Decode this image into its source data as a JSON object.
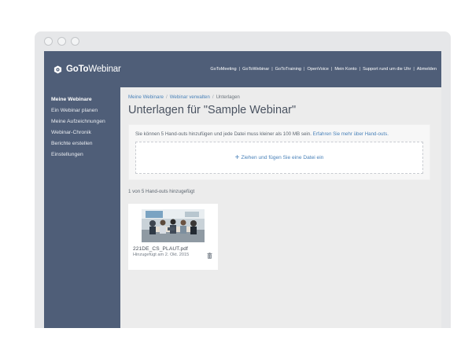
{
  "app": {
    "logo": {
      "brand_bold": "GoTo",
      "brand_light": "Webinar",
      "icon": "gotowebinar-logo-icon"
    }
  },
  "header": {
    "nav": [
      {
        "label": "GoToMeeting"
      },
      {
        "label": "GoToWebinar"
      },
      {
        "label": "GoToTraining"
      },
      {
        "label": "OpenVoice"
      },
      {
        "label": "Mein Konto"
      },
      {
        "label": "Support rund um die Uhr"
      },
      {
        "label": "Abmelden"
      }
    ]
  },
  "sidebar": {
    "items": [
      {
        "label": "Meine Webinare",
        "active": true
      },
      {
        "label": "Ein Webinar planen"
      },
      {
        "label": "Meine Aufzeichnungen"
      },
      {
        "label": "Webinar-Chronik"
      },
      {
        "label": "Berichte erstellen"
      },
      {
        "label": "Einstellungen"
      }
    ]
  },
  "main": {
    "breadcrumb": [
      {
        "label": "Meine Webinare"
      },
      {
        "label": "Webinar verwalten"
      },
      {
        "label": "Unterlagen"
      }
    ],
    "breadcrumb_separator": "/",
    "title": "Unterlagen für \"Sample Webinar\"",
    "upload": {
      "info_text": "Sie können 5 Hand-outs hinzufügen und jede Datei muss kleiner als 100 MB sein.",
      "learn_more_link": "Erfahren Sie mehr über Hand-outs.",
      "dropzone_label": "Ziehen und fügen Sie eine Datei ein",
      "dropzone_icon": "plus-icon"
    },
    "count_text": "1 von 5 Hand-outs hinzugefügt",
    "files": [
      {
        "name": "221DE_CS_PLAUT.pdf",
        "added": "Hinzugefügt am 2. Okt. 2015",
        "thumbnail": "meeting-photo-thumbnail",
        "delete_icon": "trash-icon"
      }
    ]
  },
  "colors": {
    "header_bg": "#4f5e78",
    "sidebar_bg": "#4f5e78",
    "link": "#4a82b9",
    "content_bg": "#ececec"
  }
}
